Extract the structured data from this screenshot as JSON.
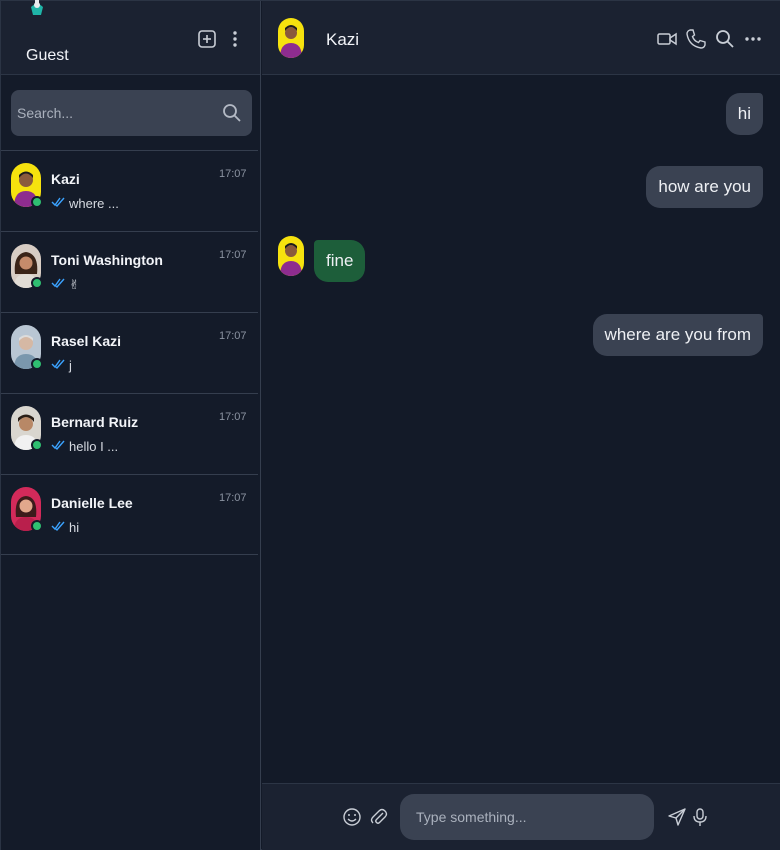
{
  "colors": {
    "background": "#131a28",
    "header": "#1b2231",
    "bubble_out": "#3a4252",
    "bubble_in": "#1d5e3a",
    "online": "#2fbf71",
    "check": "#3ba3ff"
  },
  "sidebar": {
    "user_name": "Guest",
    "icons": {
      "new_chat": "plus-square-icon",
      "menu": "vertical-dots-icon"
    },
    "search": {
      "placeholder": "Search...",
      "icon": "search-icon"
    },
    "chats": [
      {
        "name": "Kazi",
        "time": "17:07",
        "preview": "where ...",
        "online": true
      },
      {
        "name": "Toni Washington",
        "time": "17:07",
        "preview": "✌",
        "online": true
      },
      {
        "name": "Rasel Kazi",
        "time": "17:07",
        "preview": "j",
        "online": true
      },
      {
        "name": "Bernard Ruiz",
        "time": "17:07",
        "preview": "hello I ...",
        "online": true
      },
      {
        "name": "Danielle Lee",
        "time": "17:07",
        "preview": "hi",
        "online": true
      }
    ]
  },
  "chat": {
    "contact_name": "Kazi",
    "header_icons": [
      "video-call-icon",
      "phone-icon",
      "search-icon",
      "more-horizontal-icon"
    ],
    "messages": [
      {
        "direction": "out",
        "text": "hi"
      },
      {
        "direction": "out",
        "text": "how are you"
      },
      {
        "direction": "in",
        "text": "fine"
      },
      {
        "direction": "out",
        "text": "where are you from"
      }
    ],
    "composer": {
      "placeholder": "Type something...",
      "icons": [
        "emoji-icon",
        "attachment-icon",
        "send-icon",
        "microphone-icon"
      ]
    }
  }
}
